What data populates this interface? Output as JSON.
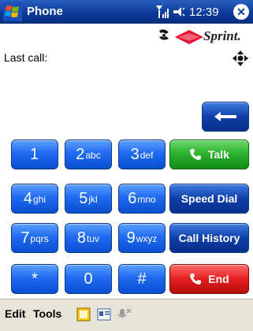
{
  "titlebar": {
    "title": "Phone",
    "time": "12:39"
  },
  "content": {
    "last_call_label": "Last call:",
    "brand": "Sprint."
  },
  "keypad": {
    "backspace_icon": "backspace-arrow-icon",
    "rows": [
      [
        {
          "digit": "1",
          "letters": ""
        },
        {
          "digit": "2",
          "letters": "abc"
        },
        {
          "digit": "3",
          "letters": "def"
        }
      ],
      [
        {
          "digit": "4",
          "letters": "ghi"
        },
        {
          "digit": "5",
          "letters": "jkl"
        },
        {
          "digit": "6",
          "letters": "mno"
        }
      ],
      [
        {
          "digit": "7",
          "letters": "pqrs"
        },
        {
          "digit": "8",
          "letters": "tuv"
        },
        {
          "digit": "9",
          "letters": "wxyz"
        }
      ],
      [
        {
          "digit": "*",
          "letters": ""
        },
        {
          "digit": "0",
          "letters": ""
        },
        {
          "digit": "#",
          "letters": ""
        }
      ]
    ],
    "actions": {
      "talk": "Talk",
      "speed_dial": "Speed Dial",
      "call_history": "Call History",
      "end": "End"
    }
  },
  "menubar": {
    "edit": "Edit",
    "tools": "Tools"
  },
  "colors": {
    "title_blue": "#0b3a9a",
    "key_blue": "#1f6bf0",
    "talk_green": "#29b02a",
    "end_red": "#e42020"
  }
}
